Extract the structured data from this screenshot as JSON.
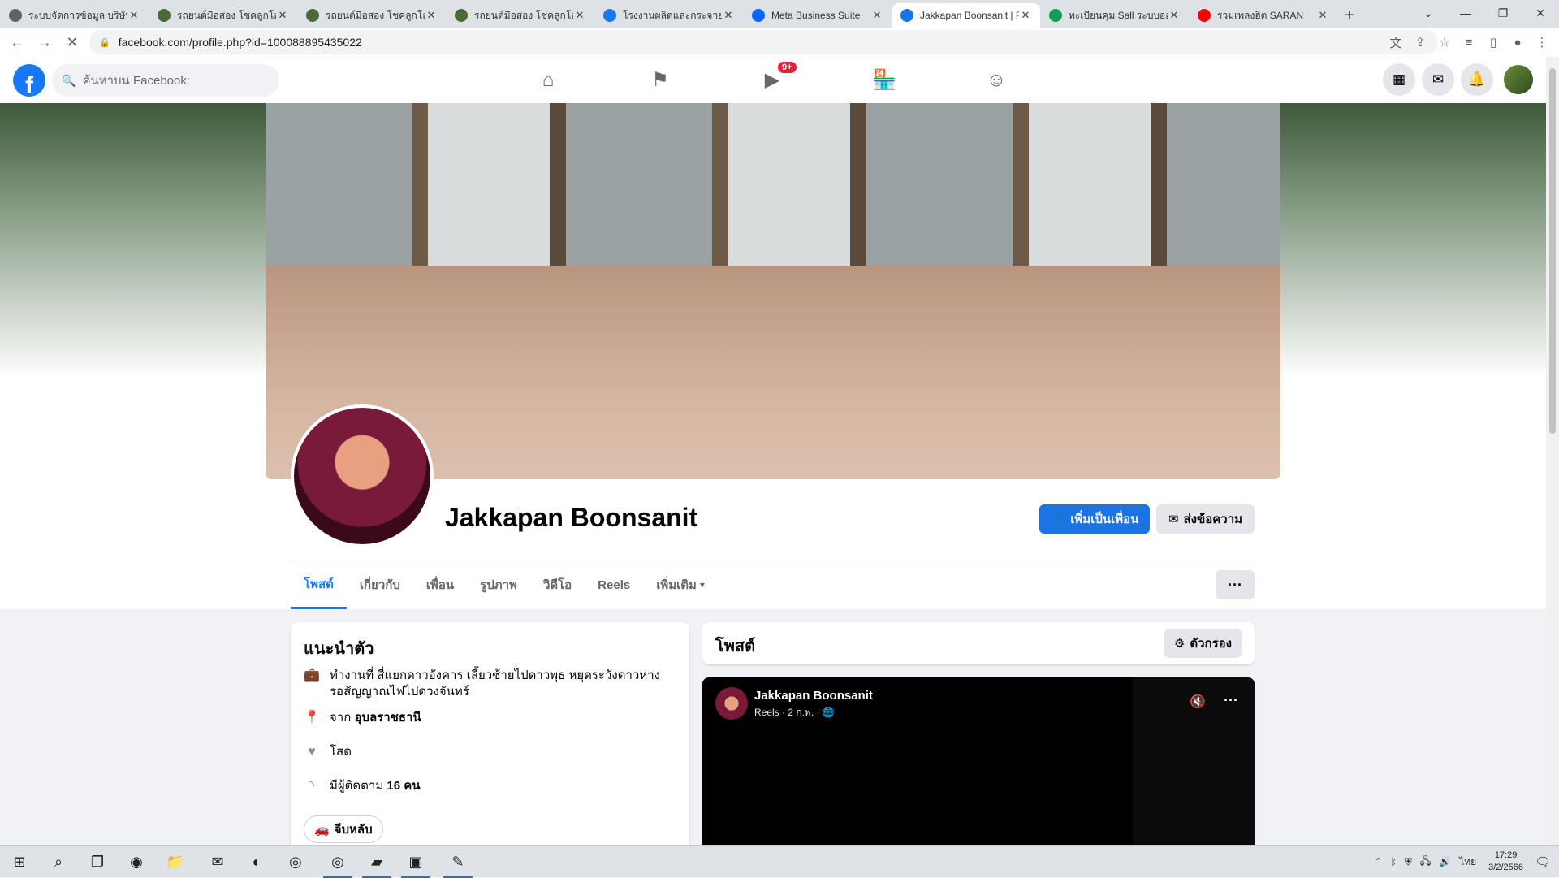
{
  "browser": {
    "tabs": [
      {
        "title": "ระบบจัดการข้อมูล บริษัท โ",
        "icon": "globe-icon",
        "color": "#5f6368"
      },
      {
        "title": "รถยนต์มือสอง โชคลูกโอ",
        "icon": "site-icon",
        "color": "#4a6a3a"
      },
      {
        "title": "รถยนต์มือสอง โชคลูกโอ",
        "icon": "site-icon",
        "color": "#4a6a3a"
      },
      {
        "title": "รถยนต์มือสอง โชคลูกโอ",
        "icon": "site-icon",
        "color": "#4a6a3a"
      },
      {
        "title": "โรงงานผลิตและกระจายรถ",
        "icon": "facebook-icon",
        "color": "#1877f2"
      },
      {
        "title": "Meta Business Suite",
        "icon": "meta-icon",
        "color": "#0866ff"
      },
      {
        "title": "Jakkapan Boonsanit | F",
        "icon": "loading-icon",
        "color": "#1a73e8"
      },
      {
        "title": "ทะเบียนคุม Sall ระบบออน",
        "icon": "sheets-icon",
        "color": "#0f9d58"
      },
      {
        "title": "รวมเพลงฮิต SARAN",
        "icon": "youtube-icon",
        "color": "#ff0000"
      }
    ],
    "url": "facebook.com/profile.php?id=100088895435022"
  },
  "facebook": {
    "search_placeholder": "ค้นหาบน Facebook:",
    "video_badge": "9+",
    "profile": {
      "name": "Jakkapan Boonsanit",
      "add_friend": "เพิ่มเป็นเพื่อน",
      "message": "ส่งข้อความ",
      "tabs": [
        "โพสต์",
        "เกี่ยวกับ",
        "เพื่อน",
        "รูปภาพ",
        "วิดีโอ",
        "Reels",
        "เพิ่มเติม"
      ],
      "more": "···"
    },
    "intro": {
      "title": "แนะนำตัว",
      "work": "ทำงานที่ สี่แยกดาวอังคาร เลี้ยวซ้ายไปดาวพุธ หยุดระวังดาวหาง รอสัญญาณไฟไปดวงจันทร์",
      "from_prefix": "จาก",
      "from_place": "อุบลราชธานี",
      "relationship": "โสด",
      "followers_prefix": "มีผู้ติดตาม",
      "followers_count": "16 คน",
      "hobby": "จีบหลับ"
    },
    "posts": {
      "title": "โพสต์",
      "filter": "ตัวกรอง",
      "reel_author": "Jakkapan Boonsanit",
      "reel_sub": "Reels · 2 ก.พ. · 🌐"
    }
  },
  "taskbar": {
    "lang": "ไทย",
    "time": "17:29",
    "date": "3/2/2566"
  }
}
